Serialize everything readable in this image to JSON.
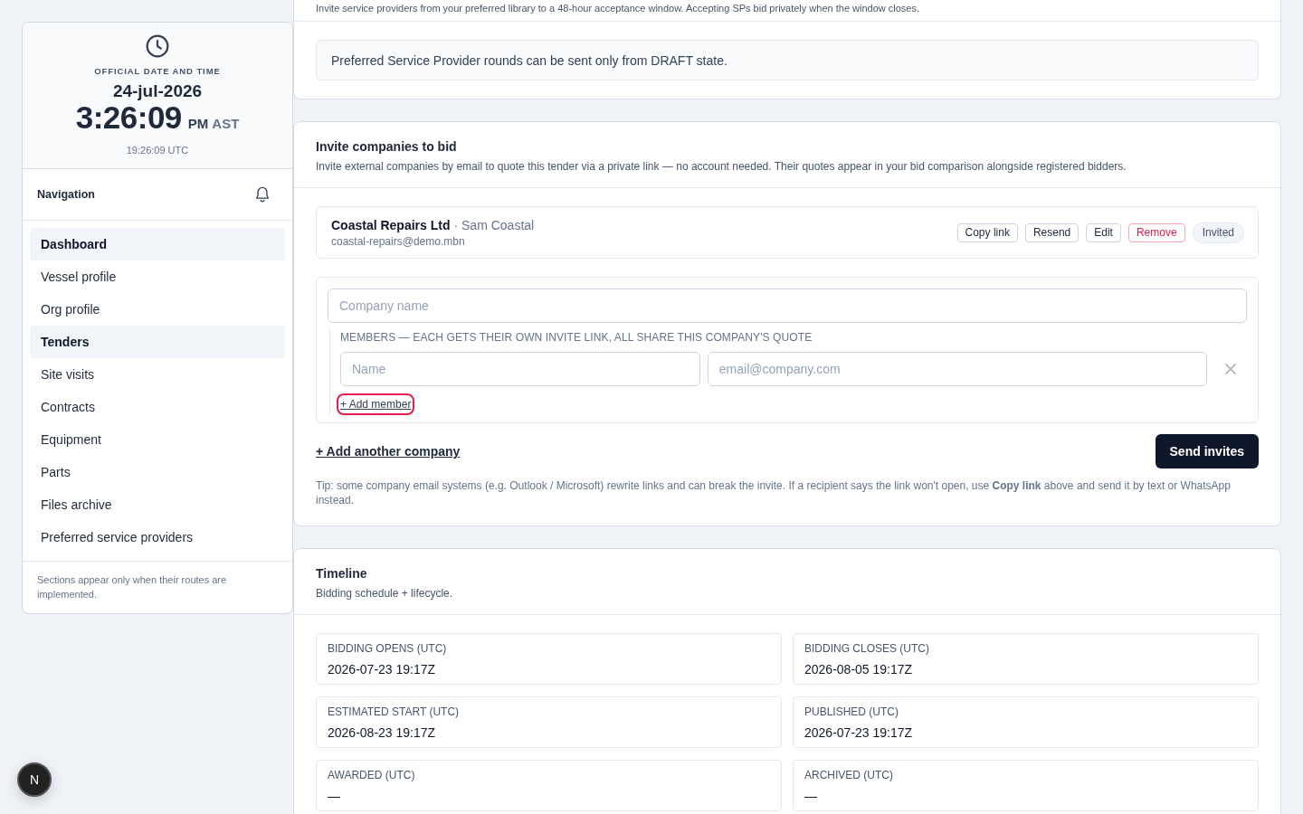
{
  "sidebar": {
    "clock": {
      "label": "OFFICIAL DATE AND TIME",
      "date": "24-jul-2026",
      "time": "3:26:09",
      "meridiem": "PM",
      "zone": "AST",
      "utc": "19:26:09 UTC"
    },
    "nav_title": "Navigation",
    "items": [
      {
        "label": "Dashboard",
        "selected": true
      },
      {
        "label": "Vessel profile",
        "selected": false
      },
      {
        "label": "Org profile",
        "selected": false
      },
      {
        "label": "Tenders",
        "selected": true
      },
      {
        "label": "Site visits",
        "selected": false
      },
      {
        "label": "Contracts",
        "selected": false
      },
      {
        "label": "Equipment",
        "selected": false
      },
      {
        "label": "Parts",
        "selected": false
      },
      {
        "label": "Files archive",
        "selected": false
      },
      {
        "label": "Preferred service providers",
        "selected": false
      }
    ],
    "footer_note": "Sections appear only when their routes are implemented."
  },
  "dev_badge": {
    "label": "N"
  },
  "preferred_providers_card": {
    "description": "Invite service providers from your preferred library to a 48-hour acceptance window. Accepting SPs bid privately when the window closes.",
    "notice": "Preferred Service Provider rounds can be sent only from DRAFT state."
  },
  "invite_card": {
    "title": "Invite companies to bid",
    "description": "Invite external companies by email to quote this tender via a private link — no account needed. Their quotes appear in your bid comparison alongside registered bidders.",
    "invited": [
      {
        "company": "Coastal Repairs Ltd",
        "contact": "· Sam Coastal",
        "email": "coastal-repairs@demo.mbn",
        "actions": [
          {
            "label": "Copy link",
            "kind": "default"
          },
          {
            "label": "Resend",
            "kind": "default"
          },
          {
            "label": "Edit",
            "kind": "default"
          },
          {
            "label": "Remove",
            "kind": "danger"
          }
        ],
        "status": "Invited"
      }
    ],
    "form": {
      "company_placeholder": "Company name",
      "members_label": "MEMBERS — EACH GETS THEIR OWN INVITE LINK, ALL SHARE THIS COMPANY'S QUOTE",
      "members": [
        {
          "name_placeholder": "Name",
          "email_placeholder": "email@company.com"
        }
      ],
      "add_member": {
        "label": "+ Add member",
        "focused": true
      }
    },
    "add_company": "+ Add another company",
    "send_button": "Send invites",
    "tip": "Tip: some company email systems (e.g. Outlook / Microsoft) rewrite links and can break the invite. If a recipient says the link won't open, use **Copy link** above and send it by text or WhatsApp instead."
  },
  "timeline_card": {
    "title": "Timeline",
    "description": "Bidding schedule + lifecycle.",
    "fields": [
      {
        "label": "BIDDING OPENS (UTC)",
        "value": "2026-07-23 19:17Z"
      },
      {
        "label": "BIDDING CLOSES (UTC)",
        "value": "2026-08-05 19:17Z"
      },
      {
        "label": "ESTIMATED START (UTC)",
        "value": "2026-08-23 19:17Z"
      },
      {
        "label": "PUBLISHED (UTC)",
        "value": "2026-07-23 19:17Z"
      },
      {
        "label": "AWARDED (UTC)",
        "value": "—"
      },
      {
        "label": "ARCHIVED (UTC)",
        "value": "—"
      }
    ]
  }
}
